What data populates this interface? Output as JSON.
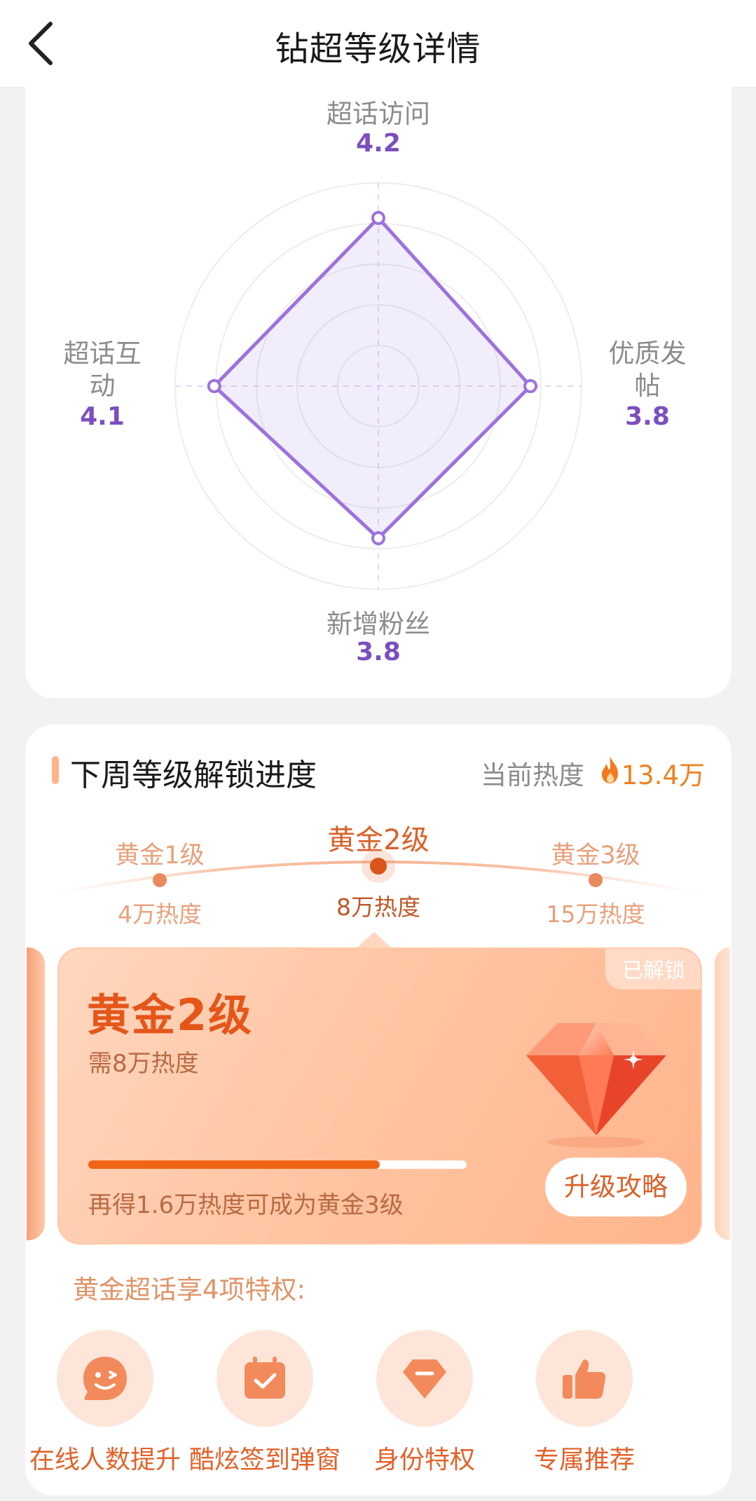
{
  "header": {
    "title": "钻超等级详情"
  },
  "radar": {
    "axes": [
      {
        "label": "超话访问",
        "value": "4.2"
      },
      {
        "label": "优质发帖",
        "value": "3.8"
      },
      {
        "label": "新增粉丝",
        "value": "3.8"
      },
      {
        "label": "超话互动",
        "value": "4.1"
      }
    ],
    "max": 5,
    "accent": "#9d72dc"
  },
  "progress_section": {
    "title": "下周等级解锁进度",
    "heat_label": "当前热度",
    "heat_value": "13.4万",
    "levels": [
      {
        "name": "黄金1级",
        "requirement": "4万热度"
      },
      {
        "name": "黄金2级",
        "requirement": "8万热度"
      },
      {
        "name": "黄金3级",
        "requirement": "15万热度"
      }
    ],
    "card": {
      "badge": "已解锁",
      "level": "黄金2级",
      "need": "需8万热度",
      "progress": 0.77,
      "progress_text": "再得1.6万热度可成为黄金3级",
      "guide_button": "升级攻略"
    },
    "privileges_title": "黄金超话享4项特权:",
    "privileges": [
      {
        "label": "在线人数提升",
        "icon": "smile-face-icon"
      },
      {
        "label": "酷炫签到弹窗",
        "icon": "calendar-check-icon"
      },
      {
        "label": "身份特权",
        "icon": "diamond-icon"
      },
      {
        "label": "专属推荐",
        "icon": "thumbs-up-icon"
      }
    ]
  },
  "colors": {
    "accent_orange": "#f06414",
    "purple": "#7b4fbf"
  }
}
